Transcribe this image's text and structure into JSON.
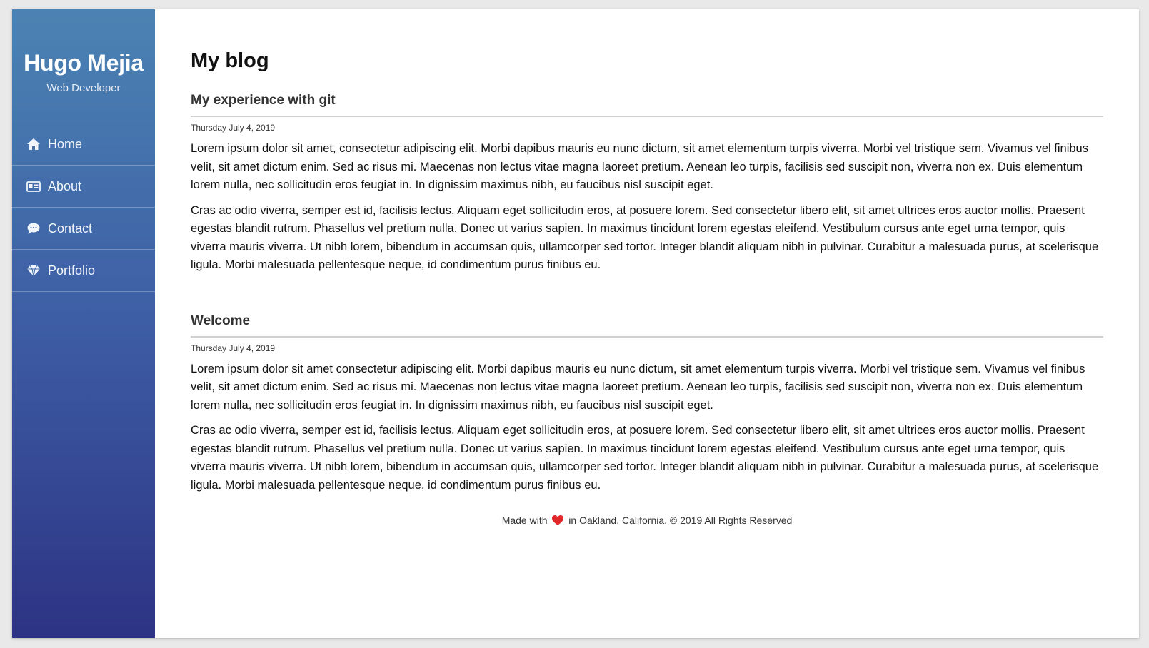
{
  "sidebar": {
    "name": "Hugo Mejia",
    "subtitle": "Web Developer",
    "items": [
      {
        "label": "Home",
        "icon": "home-icon"
      },
      {
        "label": "About",
        "icon": "id-card-icon"
      },
      {
        "label": "Contact",
        "icon": "comment-icon"
      },
      {
        "label": "Portfolio",
        "icon": "diamond-icon"
      }
    ]
  },
  "main": {
    "title": "My blog",
    "posts": [
      {
        "title": "My experience with git",
        "date": "Thursday July 4, 2019",
        "paragraphs": [
          "Lorem ipsum dolor sit amet, consectetur adipiscing elit. Morbi dapibus mauris eu nunc dictum, sit amet elementum turpis viverra. Morbi vel tristique sem. Vivamus vel finibus velit, sit amet dictum enim. Sed ac risus mi. Maecenas non lectus vitae magna laoreet pretium. Aenean leo turpis, facilisis sed suscipit non, viverra non ex. Duis elementum lorem nulla, nec sollicitudin eros feugiat in. In dignissim maximus nibh, eu faucibus nisl suscipit eget.",
          "Cras ac odio viverra, semper est id, facilisis lectus. Aliquam eget sollicitudin eros, at posuere lorem. Sed consectetur libero elit, sit amet ultrices eros auctor mollis. Praesent egestas blandit rutrum. Phasellus vel pretium nulla. Donec ut varius sapien. In maximus tincidunt lorem egestas eleifend. Vestibulum cursus ante eget urna tempor, quis viverra mauris viverra. Ut nibh lorem, bibendum in accumsan quis, ullamcorper sed tortor. Integer blandit aliquam nibh in pulvinar. Curabitur a malesuada purus, at scelerisque ligula. Morbi malesuada pellentesque neque, id condimentum purus finibus eu."
        ]
      },
      {
        "title": "Welcome",
        "date": "Thursday July 4, 2019",
        "paragraphs": [
          "Lorem ipsum dolor sit amet consectetur adipiscing elit. Morbi dapibus mauris eu nunc dictum, sit amet elementum turpis viverra. Morbi vel tristique sem. Vivamus vel finibus velit, sit amet dictum enim. Sed ac risus mi. Maecenas non lectus vitae magna laoreet pretium. Aenean leo turpis, facilisis sed suscipit non, viverra non ex. Duis elementum lorem nulla, nec sollicitudin eros feugiat in. In dignissim maximus nibh, eu faucibus nisl suscipit eget.",
          "Cras ac odio viverra, semper est id, facilisis lectus. Aliquam eget sollicitudin eros, at posuere lorem. Sed consectetur libero elit, sit amet ultrices eros auctor mollis. Praesent egestas blandit rutrum. Phasellus vel pretium nulla. Donec ut varius sapien. In maximus tincidunt lorem egestas eleifend. Vestibulum cursus ante eget urna tempor, quis viverra mauris viverra. Ut nibh lorem, bibendum in accumsan quis, ullamcorper sed tortor. Integer blandit aliquam nibh in pulvinar. Curabitur a malesuada purus, at scelerisque ligula. Morbi malesuada pellentesque neque, id condimentum purus finibus eu."
        ]
      }
    ]
  },
  "footer": {
    "before": "Made with",
    "after": "in Oakland, California. © 2019 All Rights Reserved"
  },
  "colors": {
    "sidebar_top": "#4b83b3",
    "sidebar_bottom": "#2d3384",
    "heart": "#e0272a"
  }
}
